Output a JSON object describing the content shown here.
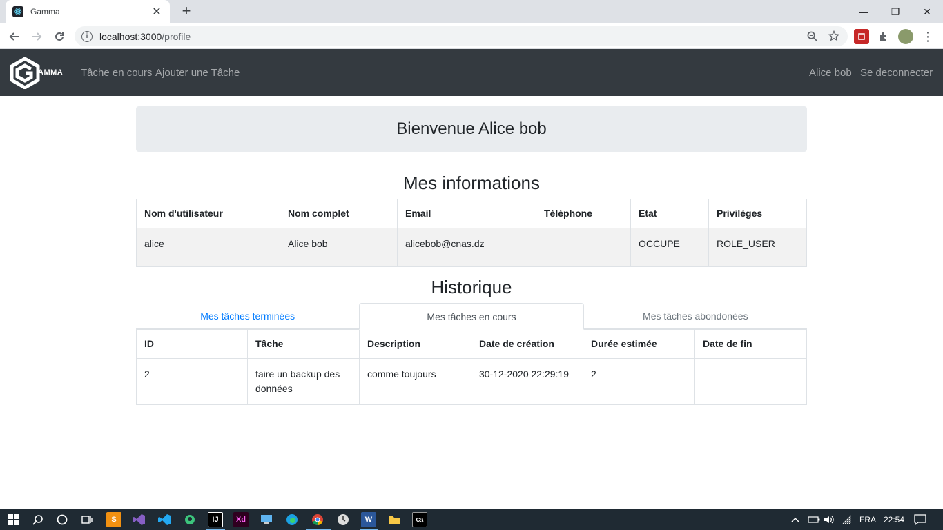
{
  "browser": {
    "tab_title": "Gamma",
    "tab_close": "✕",
    "new_tab": "+",
    "url_host": "localhost:3000",
    "url_path": "/profile",
    "minimize": "—",
    "maximize": "❐",
    "close": "✕"
  },
  "navbar": {
    "brand": "AMMA",
    "links": [
      "Tâche en cours",
      "Ajouter une Tâche"
    ],
    "user": "Alice bob",
    "logout": "Se deconnecter",
    "bg_color": "#343a40"
  },
  "welcome": "Bienvenue Alice bob",
  "info": {
    "title": "Mes informations",
    "headers": [
      "Nom d'utilisateur",
      "Nom complet",
      "Email",
      "Téléphone",
      "Etat",
      "Privilèges"
    ],
    "row": [
      "alice",
      "Alice bob",
      "alicebob@cnas.dz",
      "",
      "OCCUPE",
      "ROLE_USER"
    ]
  },
  "history": {
    "title": "Historique",
    "tabs": [
      "Mes tâches terminées",
      "Mes tâches en cours",
      "Mes tâches abondonées"
    ],
    "active_tab": "Mes tâches en cours",
    "headers": [
      "ID",
      "Tâche",
      "Description",
      "Date de création",
      "Durée estimée",
      "Date de fin"
    ],
    "rows": [
      [
        "2",
        "faire un backup des données",
        "comme toujours",
        "30-12-2020 22:29:19",
        "2",
        ""
      ]
    ]
  },
  "taskbar": {
    "language": "FRA",
    "time": "22:54"
  }
}
